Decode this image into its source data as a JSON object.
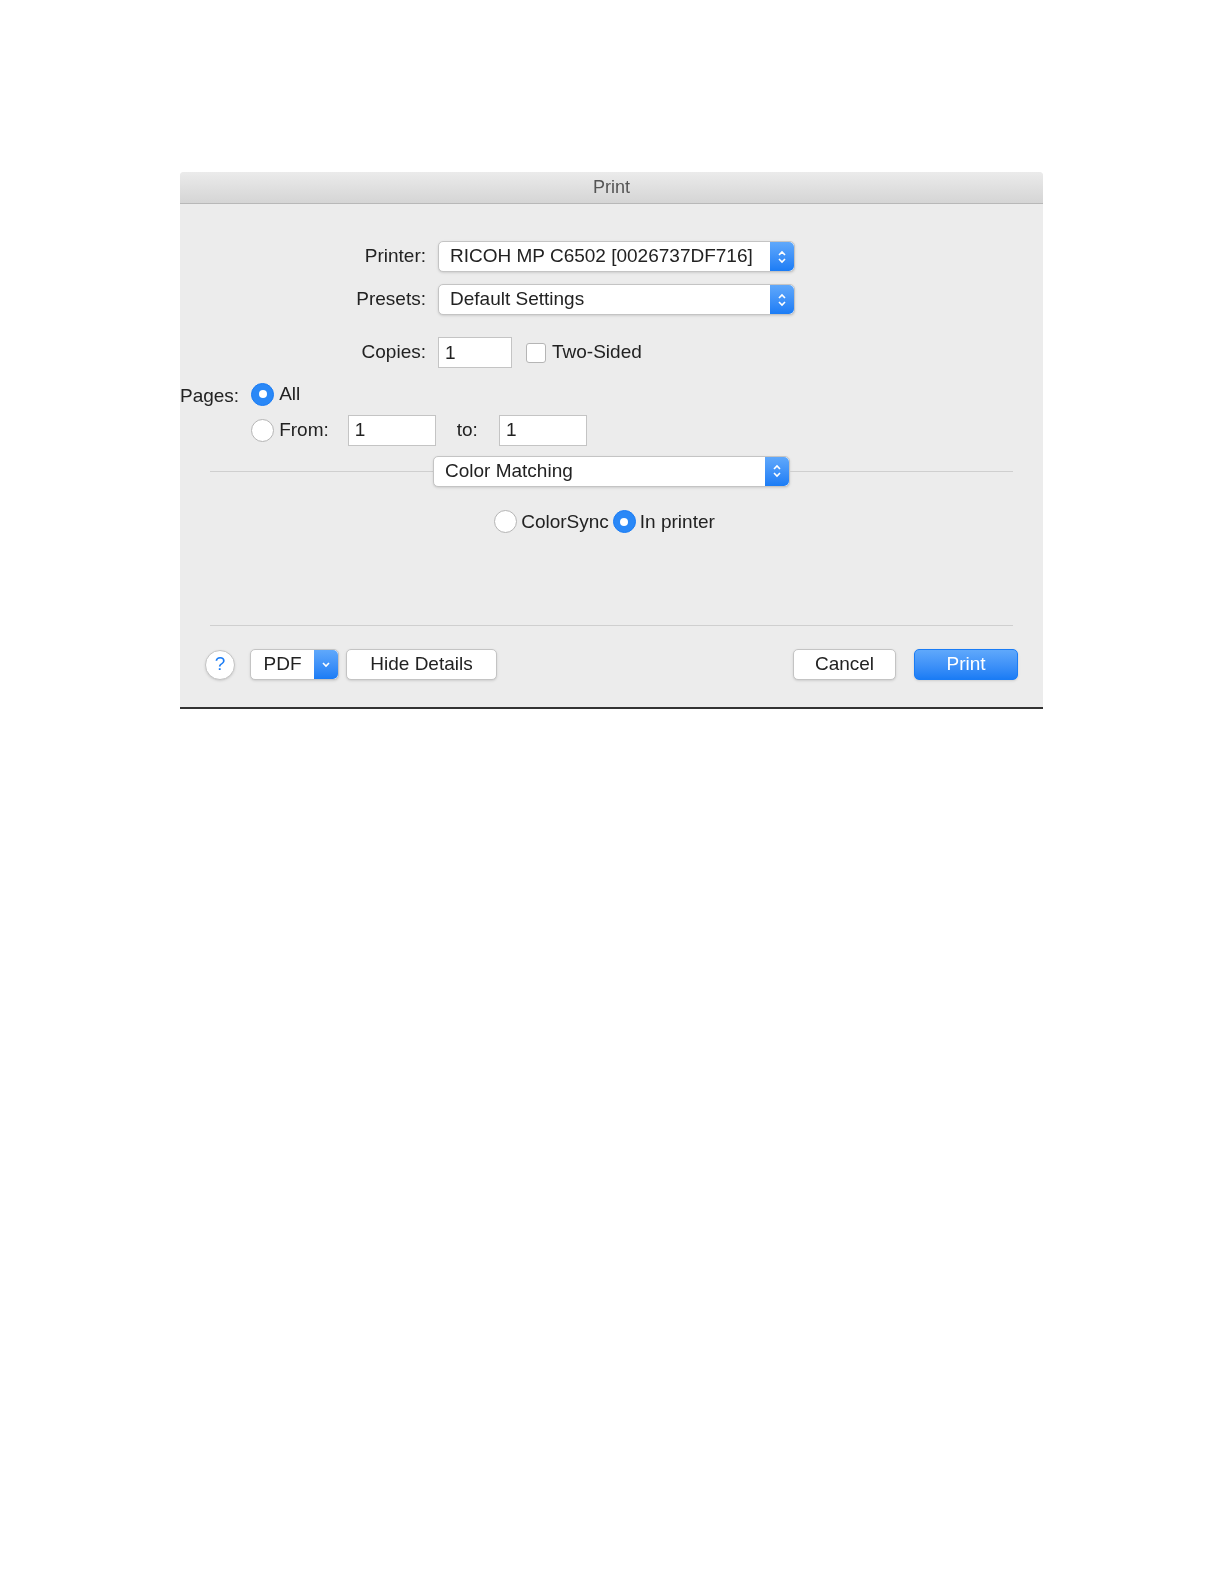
{
  "window": {
    "title": "Print"
  },
  "printer": {
    "label": "Printer:",
    "value": "RICOH MP C6502 [0026737DF716]"
  },
  "presets": {
    "label": "Presets:",
    "value": "Default Settings"
  },
  "copies": {
    "label": "Copies:",
    "value": "1"
  },
  "two_sided": {
    "label": "Two-Sided",
    "checked": false
  },
  "pages": {
    "label": "Pages:",
    "options": [
      {
        "kind": "all",
        "label": "All",
        "selected": true
      },
      {
        "kind": "range",
        "label": "From:",
        "selected": false,
        "from": "1",
        "to_label": "to:",
        "to": "1"
      }
    ]
  },
  "panel": {
    "value": "Color Matching"
  },
  "color_matching": {
    "options": [
      {
        "label": "ColorSync",
        "selected": false
      },
      {
        "label": "In printer",
        "selected": true
      }
    ]
  },
  "buttons": {
    "help": "?",
    "pdf": "PDF",
    "hide_details": "Hide Details",
    "cancel": "Cancel",
    "print": "Print"
  }
}
